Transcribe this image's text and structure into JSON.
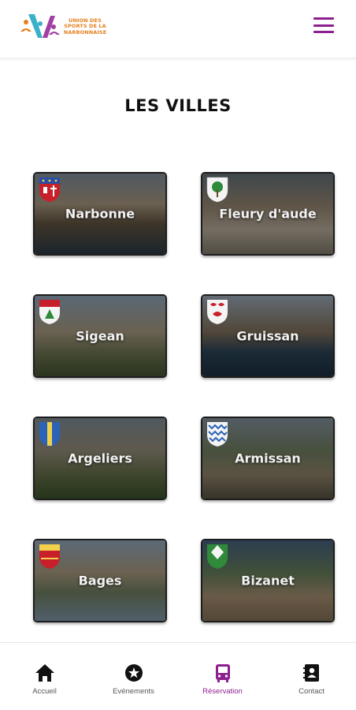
{
  "header": {
    "logo_text": "UNION DES SPORTS DE LA NARBONNAISE",
    "menu_icon": "hamburger-menu-icon",
    "accent_color": "#8e1f8e"
  },
  "page": {
    "title": "LES VILLES"
  },
  "cities": [
    {
      "name": "Narbonne"
    },
    {
      "name": "Fleury d'aude"
    },
    {
      "name": "Sigean"
    },
    {
      "name": "Gruissan"
    },
    {
      "name": "Argeliers"
    },
    {
      "name": "Armissan"
    },
    {
      "name": "Bages"
    },
    {
      "name": "Bizanet"
    }
  ],
  "nav": {
    "items": [
      {
        "label": "Accueil",
        "icon": "home-icon"
      },
      {
        "label": "Evénements",
        "icon": "star-icon"
      },
      {
        "label": "Réservation",
        "icon": "bus-icon",
        "active": true
      },
      {
        "label": "Contact",
        "icon": "contact-book-icon"
      }
    ]
  }
}
